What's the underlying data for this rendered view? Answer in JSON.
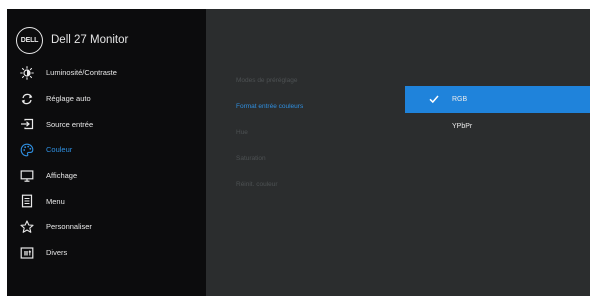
{
  "header": {
    "logo_text": "DELL",
    "title": "Dell 27 Monitor"
  },
  "menu": [
    {
      "label": "Luminosité/Contraste",
      "icon": "brightness-icon",
      "active": false
    },
    {
      "label": "Réglage auto",
      "icon": "auto-adjust-icon",
      "active": false
    },
    {
      "label": "Source entrée",
      "icon": "input-source-icon",
      "active": false
    },
    {
      "label": "Couleur",
      "icon": "palette-icon",
      "active": true
    },
    {
      "label": "Affichage",
      "icon": "display-icon",
      "active": false
    },
    {
      "label": "Menu",
      "icon": "menu-icon",
      "active": false
    },
    {
      "label": "Personnaliser",
      "icon": "star-icon",
      "active": false
    },
    {
      "label": "Divers",
      "icon": "others-icon",
      "active": false
    }
  ],
  "submenu": [
    {
      "label": "Modes de préréglage",
      "active": false
    },
    {
      "label": "Format entrée couleurs",
      "active": true
    },
    {
      "label": "Hue",
      "active": false
    },
    {
      "label": "Saturation",
      "active": false
    },
    {
      "label": "Réinit. couleur",
      "active": false
    }
  ],
  "options": [
    {
      "label": "RGB",
      "selected": true
    },
    {
      "label": "YPbPr",
      "selected": false
    }
  ],
  "colors": {
    "accent": "#1f83db",
    "active_text": "#2f8fe0",
    "sidebar_bg": "#0c0c0d",
    "panel_bg": "#2b2d2e",
    "disabled_text": "#4d5153"
  }
}
